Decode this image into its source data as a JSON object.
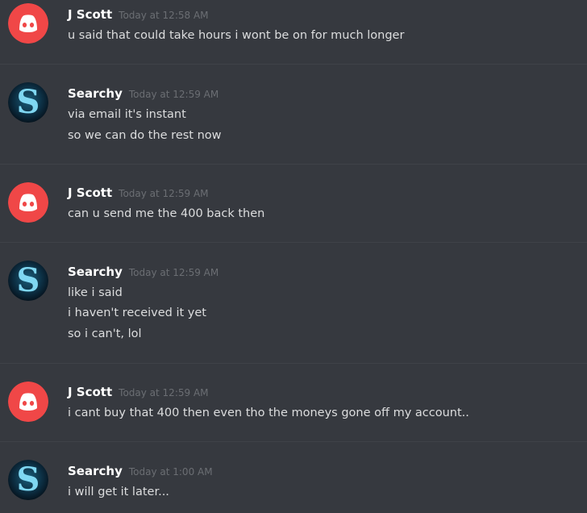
{
  "messages": [
    {
      "author": "J Scott",
      "avatar": "discord-logo-icon",
      "time": "Today at 12:58 AM",
      "lines": [
        "u said that could take hours i wont be on for much longer"
      ]
    },
    {
      "author": "Searchy",
      "avatar": "searchy-avatar-icon",
      "time": "Today at 12:59 AM",
      "lines": [
        "via email it's instant",
        "so we can do the rest now"
      ]
    },
    {
      "author": "J Scott",
      "avatar": "discord-logo-icon",
      "time": "Today at 12:59 AM",
      "lines": [
        "can u send me the 400 back then"
      ]
    },
    {
      "author": "Searchy",
      "avatar": "searchy-avatar-icon",
      "time": "Today at 12:59 AM",
      "lines": [
        "like i said",
        "i haven't received it yet",
        "so i can't, lol"
      ]
    },
    {
      "author": "J Scott",
      "avatar": "discord-logo-icon",
      "time": "Today at 12:59 AM",
      "lines": [
        "i cant buy that 400 then even tho the moneys gone off my account.."
      ]
    },
    {
      "author": "Searchy",
      "avatar": "searchy-avatar-icon",
      "time": "Today at 1:00 AM",
      "lines": [
        "i will get it later..."
      ]
    }
  ],
  "colors": {
    "background": "#36393f",
    "discord_avatar": "#f04747",
    "username": "#ffffff",
    "message_text": "#dcddde",
    "timestamp": "#72767d"
  }
}
